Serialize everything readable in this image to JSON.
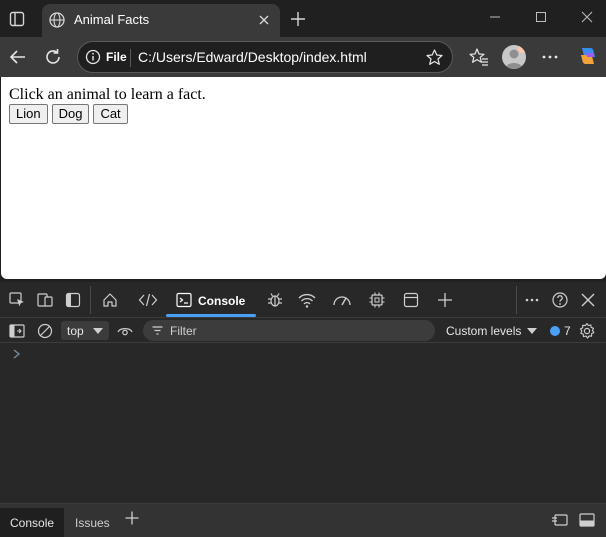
{
  "browser": {
    "tab_title": "Animal Facts",
    "address": {
      "scheme_badge": "File",
      "url": "C:/Users/Edward/Desktop/index.html"
    }
  },
  "page": {
    "prompt_text": "Click an animal to learn a fact.",
    "buttons": [
      "Lion",
      "Dog",
      "Cat"
    ]
  },
  "devtools": {
    "active_tab": "Console",
    "context": "top",
    "filter_placeholder": "Filter",
    "levels_label": "Custom levels",
    "issues_count": "7",
    "drawer_tabs": [
      "Console",
      "Issues"
    ]
  },
  "colors": {
    "accent": "#4aa0f5",
    "chrome_dark": "#202020",
    "toolbar": "#3a3a3a",
    "devtools_bg": "#282828"
  }
}
